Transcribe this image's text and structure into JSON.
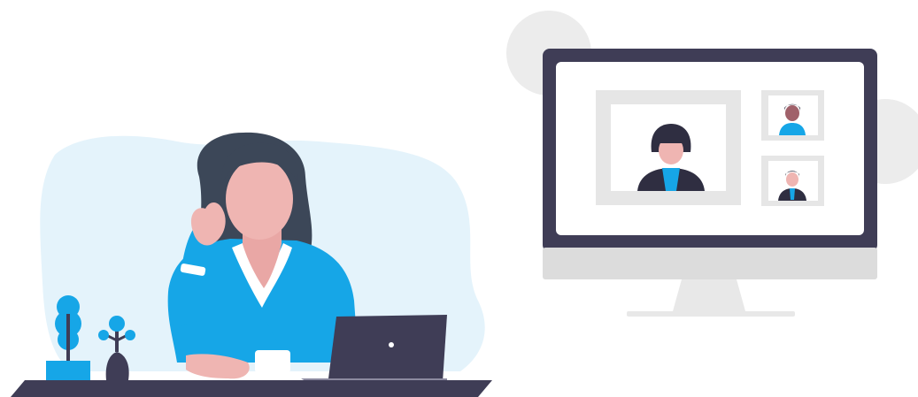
{
  "illustration": {
    "subject": "remote-video-meeting",
    "elements": [
      "woman-at-desk",
      "laptop",
      "potted-plants",
      "desktop-monitor",
      "video-call-tiles"
    ],
    "video_call": {
      "participant_tiles": 3
    }
  },
  "colors": {
    "background": "#ffffff",
    "blob": "#e4f3fb",
    "accent_blue": "#16a6e7",
    "dark_navy": "#3f3d56",
    "hair": "#3c4758",
    "skin": "#efb5b2",
    "collar": "#ffffff",
    "monitor_frame": "#3f3d56",
    "monitor_stand": "#e5e5e5",
    "tile_gray": "#e6e6e6",
    "circle_gray": "#ececec",
    "desk": "#3f3d56"
  }
}
